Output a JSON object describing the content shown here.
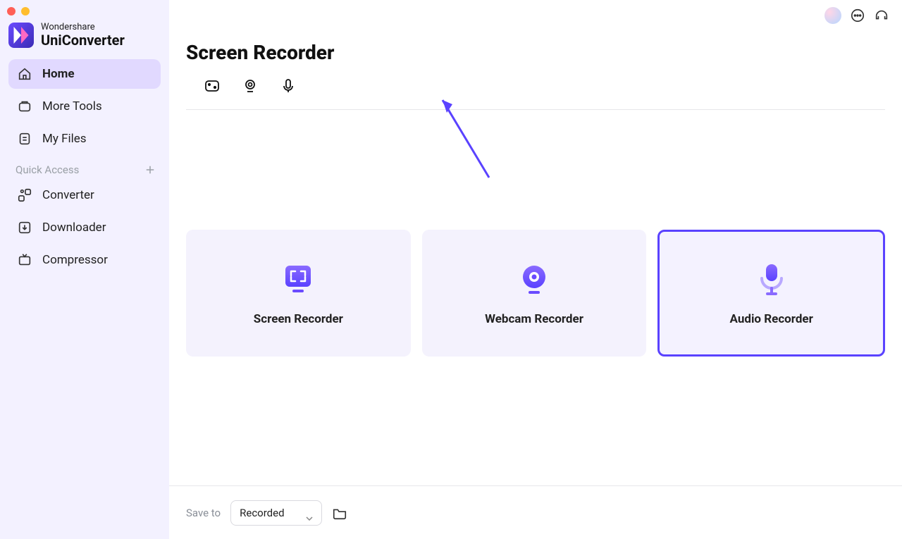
{
  "brand": {
    "top": "Wondershare",
    "bottom": "UniConverter"
  },
  "sidebar": {
    "items": [
      {
        "label": "Home",
        "icon": "home-icon",
        "active": true
      },
      {
        "label": "More Tools",
        "icon": "tools-icon",
        "active": false
      },
      {
        "label": "My Files",
        "icon": "files-icon",
        "active": false
      }
    ],
    "quick_access_label": "Quick Access",
    "quick_items": [
      {
        "label": "Converter",
        "icon": "converter-icon"
      },
      {
        "label": "Downloader",
        "icon": "downloader-icon"
      },
      {
        "label": "Compressor",
        "icon": "compressor-icon"
      }
    ]
  },
  "page": {
    "title": "Screen Recorder"
  },
  "tabs": [
    {
      "name": "screen-tab",
      "icon": "screen-rect-icon"
    },
    {
      "name": "webcam-tab",
      "icon": "webcam-icon"
    },
    {
      "name": "audio-tab",
      "icon": "mic-icon"
    }
  ],
  "cards": [
    {
      "label": "Screen Recorder",
      "icon": "screen-recorder-card-icon",
      "highlight": false
    },
    {
      "label": "Webcam Recorder",
      "icon": "webcam-recorder-card-icon",
      "highlight": false
    },
    {
      "label": "Audio Recorder",
      "icon": "audio-recorder-card-icon",
      "highlight": true
    }
  ],
  "bottom": {
    "save_to_label": "Save to",
    "dropdown_value": "Recorded"
  },
  "annotation": {
    "arrow_color": "#5a42ff"
  }
}
